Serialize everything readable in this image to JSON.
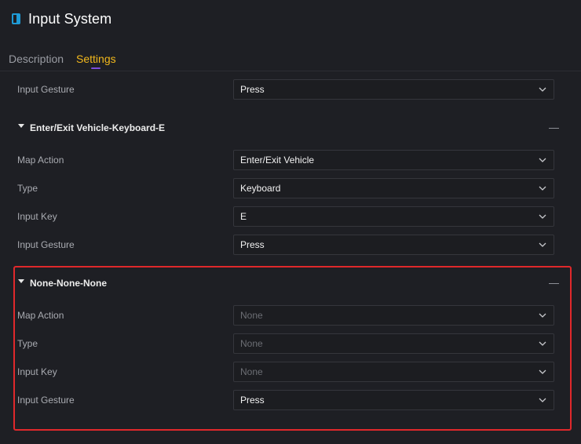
{
  "header": {
    "title": "Input System",
    "icon": "panel-icon"
  },
  "tabs": [
    {
      "label": "Description",
      "active": false
    },
    {
      "label": "Settings",
      "active": true
    }
  ],
  "top_row": {
    "label": "Input Gesture",
    "value": "Press"
  },
  "sections": [
    {
      "title": "Enter/Exit Vehicle-Keyboard-E",
      "rows": [
        {
          "label": "Map Action",
          "value": "Enter/Exit Vehicle"
        },
        {
          "label": "Type",
          "value": "Keyboard"
        },
        {
          "label": "Input Key",
          "value": "E"
        },
        {
          "label": "Input Gesture",
          "value": "Press"
        }
      ]
    },
    {
      "title": "None-None-None",
      "rows": [
        {
          "label": "Map Action",
          "value": "None"
        },
        {
          "label": "Type",
          "value": "None"
        },
        {
          "label": "Input Key",
          "value": "None"
        },
        {
          "label": "Input Gesture",
          "value": "Press"
        }
      ]
    }
  ],
  "colors": {
    "background": "#1e1f24",
    "active_tab": "#f2b81c",
    "tab_indicator": "#7c4ddc",
    "highlight_border": "#e0282b",
    "icon": "#1f9bd6"
  }
}
